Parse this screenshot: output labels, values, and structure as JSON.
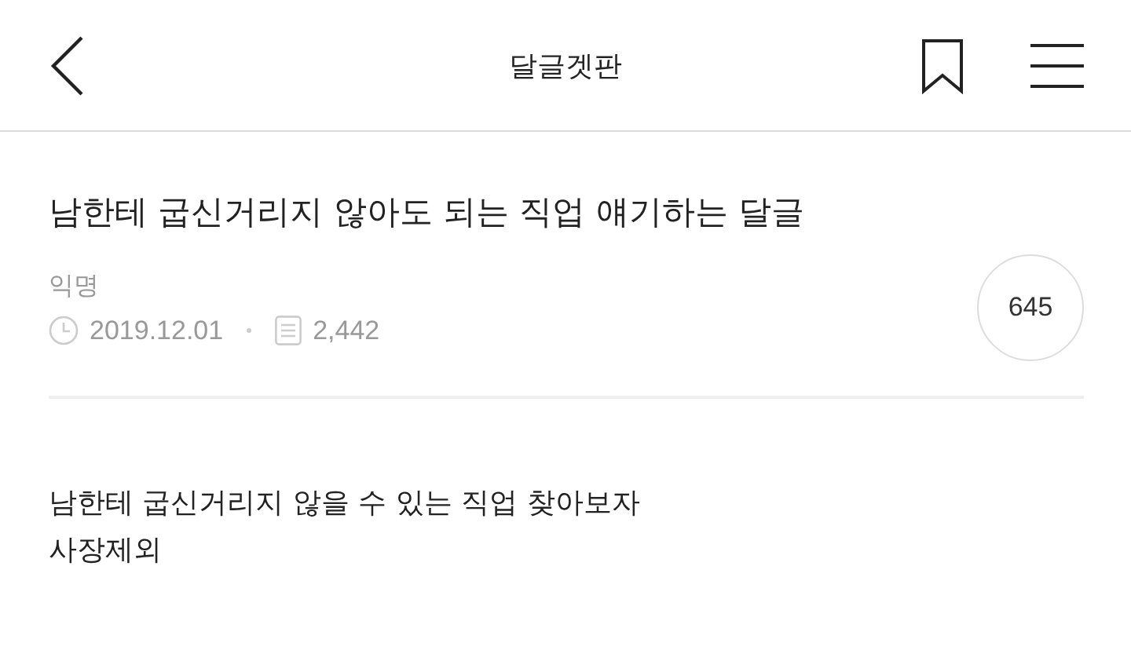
{
  "header": {
    "title": "달글겟판"
  },
  "post": {
    "title": "남한테 굽신거리지 않아도 되는 직업 얘기하는 달글",
    "author": "익명",
    "date": "2019.12.01",
    "views": "2,442",
    "comments": "645"
  },
  "body": [
    "남한테 굽신거리지 않을 수 있는 직업 찾아보자",
    "사장제외"
  ]
}
